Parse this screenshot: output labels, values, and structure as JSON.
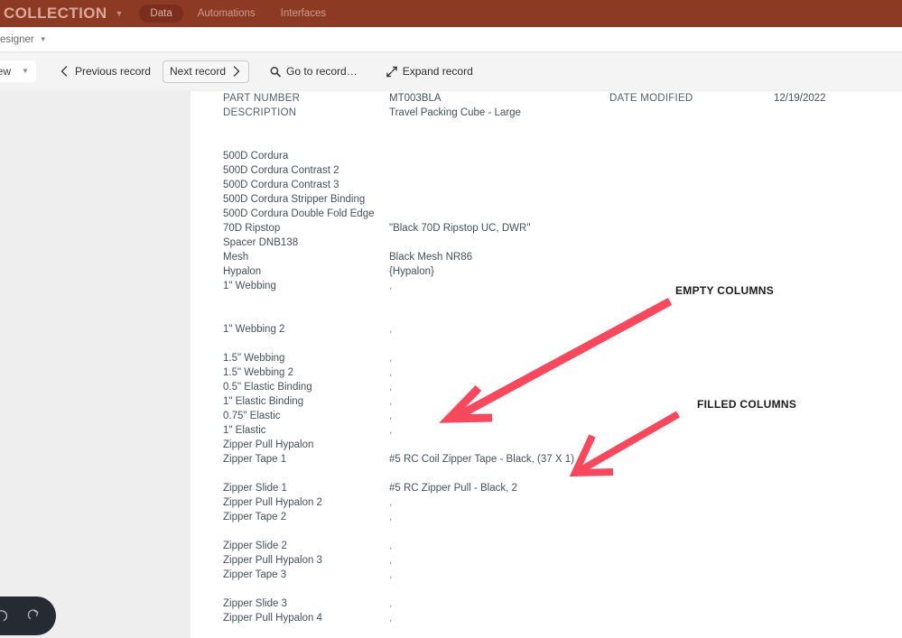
{
  "topbar": {
    "brand_title": "COLLECTION",
    "brand_caret": "▼",
    "bg_color": "#8c3a24",
    "nav": [
      {
        "label": "Data",
        "active": true
      },
      {
        "label": "Automations",
        "active": false
      },
      {
        "label": "Interfaces",
        "active": false
      }
    ]
  },
  "breadcrumb_bar": {
    "label": "esigner",
    "caret": "▼"
  },
  "toolbar": {
    "view_pill": {
      "label": "view",
      "caret": "▼"
    },
    "previous_record": "Previous record",
    "next_record": "Next record",
    "go_to_record": "Go to record…",
    "expand_record": "Expand record"
  },
  "record": {
    "part_number_label": "PART NUMBER",
    "part_number_value": "MT003BLA",
    "description_label": "DESCRIPTION",
    "description_value": "Travel Packing Cube - Large",
    "date_modified_label": "DATE MODIFIED",
    "date_modified_value": "12/19/2022",
    "rows": [
      {
        "label": "500D Cordura",
        "value": ""
      },
      {
        "label": "500D Cordura Contrast 2",
        "value": ""
      },
      {
        "label": "500D Cordura Contrast 3",
        "value": ""
      },
      {
        "label": "500D Cordura Stripper Binding",
        "value": ""
      },
      {
        "label": "500D Cordura Double Fold Edge",
        "value": ""
      },
      {
        "label": "70D Ripstop",
        "value": "\"Black 70D Ripstop UC, DWR\""
      },
      {
        "label": "Spacer DNB138",
        "value": ""
      },
      {
        "label": "Mesh",
        "value": "Black Mesh NR86"
      },
      {
        "label": "Hypalon",
        "value": "{Hypalon}"
      },
      {
        "label": "1\" Webbing",
        "value": ","
      },
      {
        "label": "",
        "value": ""
      },
      {
        "label": "",
        "value": ""
      },
      {
        "label": "1\" Webbing 2",
        "value": ","
      },
      {
        "label": "",
        "value": ""
      },
      {
        "label": "1.5\" Webbing",
        "value": ","
      },
      {
        "label": "1.5\" Webbing 2",
        "value": ","
      },
      {
        "label": "0.5\" Elastic Binding",
        "value": ","
      },
      {
        "label": "1\" Elastic Binding",
        "value": ","
      },
      {
        "label": "0.75\" Elastic",
        "value": ","
      },
      {
        "label": "1\" Elastic",
        "value": ","
      },
      {
        "label": "Zipper Pull Hypalon",
        "value": ""
      },
      {
        "label": "Zipper Tape 1",
        "value": "#5 RC Coil Zipper Tape - Black, (37 X 1)"
      },
      {
        "label": "",
        "value": ""
      },
      {
        "label": "Zipper Slide 1",
        "value": "#5 RC Zipper Pull - Black, 2"
      },
      {
        "label": "Zipper Pull Hypalon 2",
        "value": ","
      },
      {
        "label": "Zipper Tape 2",
        "value": ","
      },
      {
        "label": "",
        "value": ""
      },
      {
        "label": "Zipper Slide 2",
        "value": ","
      },
      {
        "label": "Zipper Pull Hypalon 3",
        "value": ","
      },
      {
        "label": "Zipper Tape 3",
        "value": ","
      },
      {
        "label": "",
        "value": ""
      },
      {
        "label": "Zipper Slide 3",
        "value": ","
      },
      {
        "label": "Zipper Pull Hypalon 4",
        "value": ","
      }
    ]
  },
  "annotations": {
    "empty_columns": "EMPTY COLUMNS",
    "filled_columns": "FILLED COLUMNS",
    "arrow_color": "#f8485e"
  },
  "undo_toast": {
    "undo_icon": "undo-icon",
    "redo_icon": "redo-icon"
  }
}
